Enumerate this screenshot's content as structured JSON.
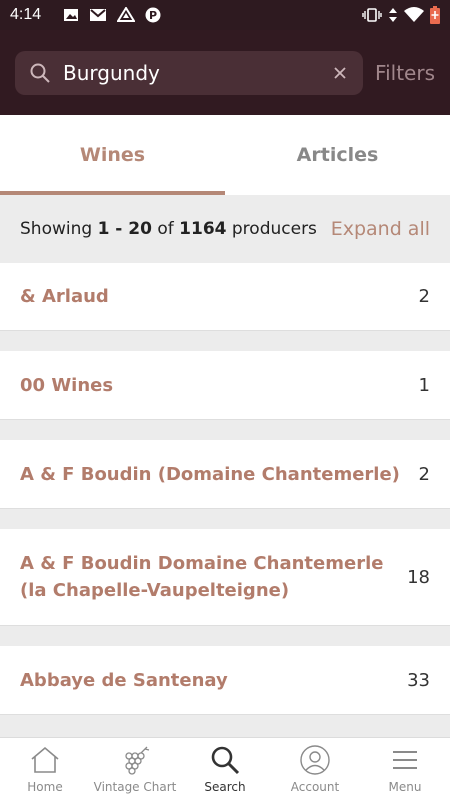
{
  "status_bar": {
    "time": "4:14",
    "icons_left": [
      "image-icon",
      "gmail-icon",
      "drive-icon",
      "p-app-icon"
    ],
    "icons_right": [
      "vibrate-icon",
      "data-icon",
      "wifi-icon",
      "battery-icon"
    ]
  },
  "search": {
    "query": "Burgundy",
    "filters_label": "Filters"
  },
  "tabs": [
    {
      "label": "Wines",
      "active": true
    },
    {
      "label": "Articles",
      "active": false
    }
  ],
  "summary": {
    "prefix": "Showing ",
    "range": "1 - 20",
    "of": " of ",
    "total": "1164",
    "suffix": " producers",
    "expand_all": "Expand all"
  },
  "producers": [
    {
      "name": "& Arlaud",
      "count": "2"
    },
    {
      "name": "00 Wines",
      "count": "1"
    },
    {
      "name": "A & F Boudin (Domaine Chantemerle)",
      "count": "2"
    },
    {
      "name": "A & F Boudin Domaine Chantemerle (la Chapelle-Vaupelteigne)",
      "count": "18"
    },
    {
      "name": "Abbaye de Santenay",
      "count": "33"
    }
  ],
  "bottom_nav": [
    {
      "label": "Home",
      "icon": "home-icon"
    },
    {
      "label": "Vintage Chart",
      "icon": "grapes-icon"
    },
    {
      "label": "Search",
      "icon": "search-icon",
      "active": true
    },
    {
      "label": "Account",
      "icon": "account-icon"
    },
    {
      "label": "Menu",
      "icon": "menu-icon"
    }
  ],
  "colors": {
    "header_bg": "#311a21",
    "accent": "#b58877",
    "producer_name": "#b27c6b"
  }
}
